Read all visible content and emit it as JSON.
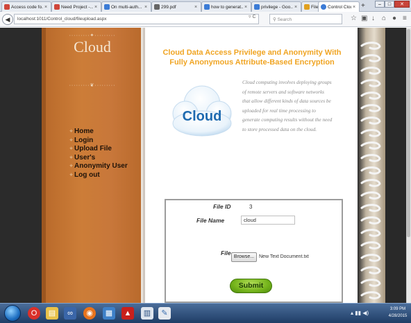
{
  "browser": {
    "tabs": [
      {
        "label": "Access code fo...",
        "color": "#d0463a",
        "active": false
      },
      {
        "label": "Need Project -...",
        "color": "#d0463a",
        "active": false
      },
      {
        "label": "On multi-auth...",
        "color": "#3b7bd6",
        "active": false
      },
      {
        "label": "299.pdf",
        "color": "#666666",
        "active": false
      },
      {
        "label": "how to generat...",
        "color": "#3b7bd6",
        "active": false
      },
      {
        "label": "privilege - Goo...",
        "color": "#3b7bd6",
        "active": false
      },
      {
        "label": "File Download ...",
        "color": "#e0a020",
        "active": false
      },
      {
        "label": "Control Cloud...",
        "color": "#3b7bd6",
        "active": true
      }
    ],
    "url": "localhost:1011/Control_cloud/fileupload.aspx",
    "search_placeholder": "Search"
  },
  "sidebar": {
    "logo": "Cloud",
    "nav": [
      "Home",
      "Login",
      "Upload File",
      "User's",
      "Anonymity User",
      "Log out"
    ]
  },
  "main": {
    "heading_line1": "Cloud Data Access Privilege and Anonymity With",
    "heading_line2": "Fully Anonymous Attribute-Based Encryption",
    "image_text": "Cloud",
    "description_lines": [
      "Cloud computing involves deploying groups",
      "of remote servers and software networks",
      "that allow different kinds of data sources be",
      "uploaded for real time processing to",
      "generate computing results without the need",
      "to store processed data on the cloud."
    ],
    "form": {
      "file_id_label": "File ID",
      "file_id_value": "3",
      "file_name_label": "File Name",
      "file_name_value": "cloud",
      "file_label": "File",
      "browse_label": "Browse...",
      "selected_file": "New Text Document.txt",
      "submit_label": "Submit"
    }
  },
  "taskbar": {
    "clock_time": "3:09 PM",
    "clock_date": "4/28/2015"
  }
}
